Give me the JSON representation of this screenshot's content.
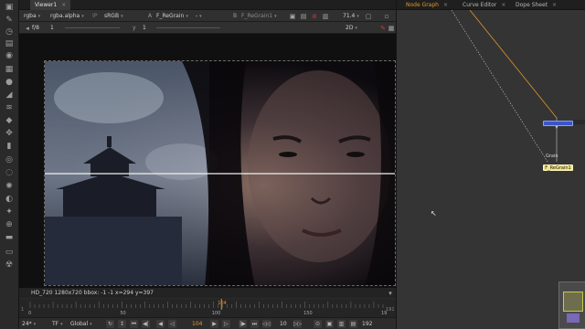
{
  "viewer": {
    "tab_label": "Viewer1",
    "channels": "rgba",
    "alpha_channel": "rgba.alpha",
    "colorspace_prefix": "IP",
    "colorspace": "sRGB",
    "input_a_letter": "A",
    "input_a_node": "F_ReGrain",
    "input_mid": "-",
    "input_b_letter": "B",
    "input_b_node": "F_ReGrain1",
    "zoom": "71.4",
    "fstop": "f/8",
    "gain": "1",
    "gamma_label": "y",
    "gamma": "1",
    "view_mode": "2D",
    "format_info": "HD_720 1280x720  bbox: -1 -1  x=294 y=397"
  },
  "timeline": {
    "ticks": [
      "0",
      "50",
      "100",
      "150",
      "19"
    ],
    "start_frame": "1",
    "end_frame": "191",
    "current_frame": "104"
  },
  "transport": {
    "fps": "24*",
    "timecode_mode": "TF",
    "scope": "Global",
    "current_frame": "104",
    "step": "10",
    "end_frame": "192"
  },
  "node_graph": {
    "tabs": [
      "Node Graph",
      "Curve Editor",
      "Dope Sheet"
    ],
    "grain_label": "Grain",
    "regrain_label": "F_ReGrain1"
  },
  "colors": {
    "accent_orange": "#e0952a",
    "selected_node": "#f2e388",
    "blue_node": "#3a55c8"
  }
}
